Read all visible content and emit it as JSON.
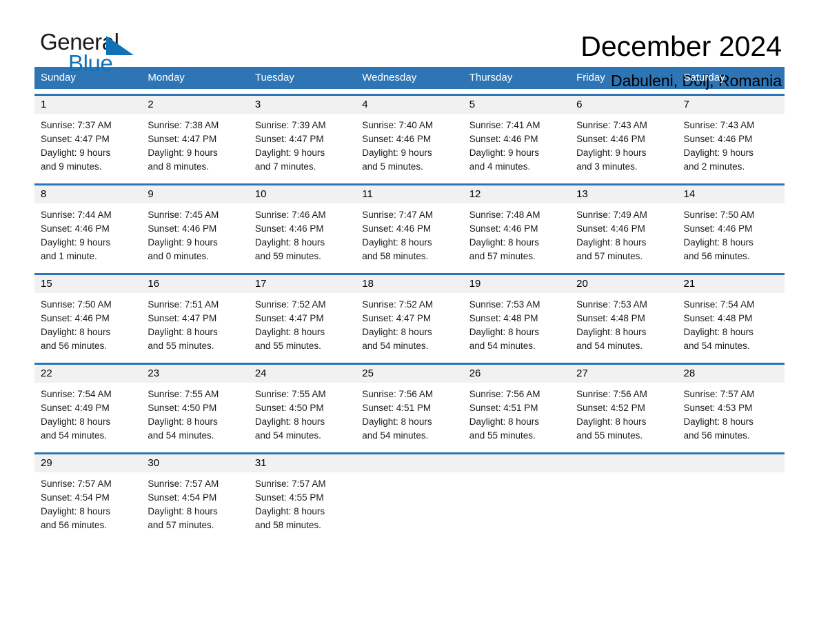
{
  "logo": {
    "word_one": "General",
    "word_two": "Blue",
    "triangle_color": "#1072b8",
    "icon": "triangle-icon"
  },
  "header": {
    "title": "December 2024",
    "subtitle": "Dabuleni, Dolj, Romania"
  },
  "colors": {
    "header_blue": "#2e75b6",
    "row_divider_blue": "#2e75b6",
    "day_strip_gray": "#f1f1f1",
    "text": "#000000",
    "logo_blue": "#1072b8"
  },
  "calendar": {
    "weekday_headers": [
      "Sunday",
      "Monday",
      "Tuesday",
      "Wednesday",
      "Thursday",
      "Friday",
      "Saturday"
    ],
    "weeks": [
      [
        {
          "day": "1",
          "sunrise": "Sunrise: 7:37 AM",
          "sunset": "Sunset: 4:47 PM",
          "daylight1": "Daylight: 9 hours",
          "daylight2": "and 9 minutes."
        },
        {
          "day": "2",
          "sunrise": "Sunrise: 7:38 AM",
          "sunset": "Sunset: 4:47 PM",
          "daylight1": "Daylight: 9 hours",
          "daylight2": "and 8 minutes."
        },
        {
          "day": "3",
          "sunrise": "Sunrise: 7:39 AM",
          "sunset": "Sunset: 4:47 PM",
          "daylight1": "Daylight: 9 hours",
          "daylight2": "and 7 minutes."
        },
        {
          "day": "4",
          "sunrise": "Sunrise: 7:40 AM",
          "sunset": "Sunset: 4:46 PM",
          "daylight1": "Daylight: 9 hours",
          "daylight2": "and 5 minutes."
        },
        {
          "day": "5",
          "sunrise": "Sunrise: 7:41 AM",
          "sunset": "Sunset: 4:46 PM",
          "daylight1": "Daylight: 9 hours",
          "daylight2": "and 4 minutes."
        },
        {
          "day": "6",
          "sunrise": "Sunrise: 7:43 AM",
          "sunset": "Sunset: 4:46 PM",
          "daylight1": "Daylight: 9 hours",
          "daylight2": "and 3 minutes."
        },
        {
          "day": "7",
          "sunrise": "Sunrise: 7:43 AM",
          "sunset": "Sunset: 4:46 PM",
          "daylight1": "Daylight: 9 hours",
          "daylight2": "and 2 minutes."
        }
      ],
      [
        {
          "day": "8",
          "sunrise": "Sunrise: 7:44 AM",
          "sunset": "Sunset: 4:46 PM",
          "daylight1": "Daylight: 9 hours",
          "daylight2": "and 1 minute."
        },
        {
          "day": "9",
          "sunrise": "Sunrise: 7:45 AM",
          "sunset": "Sunset: 4:46 PM",
          "daylight1": "Daylight: 9 hours",
          "daylight2": "and 0 minutes."
        },
        {
          "day": "10",
          "sunrise": "Sunrise: 7:46 AM",
          "sunset": "Sunset: 4:46 PM",
          "daylight1": "Daylight: 8 hours",
          "daylight2": "and 59 minutes."
        },
        {
          "day": "11",
          "sunrise": "Sunrise: 7:47 AM",
          "sunset": "Sunset: 4:46 PM",
          "daylight1": "Daylight: 8 hours",
          "daylight2": "and 58 minutes."
        },
        {
          "day": "12",
          "sunrise": "Sunrise: 7:48 AM",
          "sunset": "Sunset: 4:46 PM",
          "daylight1": "Daylight: 8 hours",
          "daylight2": "and 57 minutes."
        },
        {
          "day": "13",
          "sunrise": "Sunrise: 7:49 AM",
          "sunset": "Sunset: 4:46 PM",
          "daylight1": "Daylight: 8 hours",
          "daylight2": "and 57 minutes."
        },
        {
          "day": "14",
          "sunrise": "Sunrise: 7:50 AM",
          "sunset": "Sunset: 4:46 PM",
          "daylight1": "Daylight: 8 hours",
          "daylight2": "and 56 minutes."
        }
      ],
      [
        {
          "day": "15",
          "sunrise": "Sunrise: 7:50 AM",
          "sunset": "Sunset: 4:46 PM",
          "daylight1": "Daylight: 8 hours",
          "daylight2": "and 56 minutes."
        },
        {
          "day": "16",
          "sunrise": "Sunrise: 7:51 AM",
          "sunset": "Sunset: 4:47 PM",
          "daylight1": "Daylight: 8 hours",
          "daylight2": "and 55 minutes."
        },
        {
          "day": "17",
          "sunrise": "Sunrise: 7:52 AM",
          "sunset": "Sunset: 4:47 PM",
          "daylight1": "Daylight: 8 hours",
          "daylight2": "and 55 minutes."
        },
        {
          "day": "18",
          "sunrise": "Sunrise: 7:52 AM",
          "sunset": "Sunset: 4:47 PM",
          "daylight1": "Daylight: 8 hours",
          "daylight2": "and 54 minutes."
        },
        {
          "day": "19",
          "sunrise": "Sunrise: 7:53 AM",
          "sunset": "Sunset: 4:48 PM",
          "daylight1": "Daylight: 8 hours",
          "daylight2": "and 54 minutes."
        },
        {
          "day": "20",
          "sunrise": "Sunrise: 7:53 AM",
          "sunset": "Sunset: 4:48 PM",
          "daylight1": "Daylight: 8 hours",
          "daylight2": "and 54 minutes."
        },
        {
          "day": "21",
          "sunrise": "Sunrise: 7:54 AM",
          "sunset": "Sunset: 4:48 PM",
          "daylight1": "Daylight: 8 hours",
          "daylight2": "and 54 minutes."
        }
      ],
      [
        {
          "day": "22",
          "sunrise": "Sunrise: 7:54 AM",
          "sunset": "Sunset: 4:49 PM",
          "daylight1": "Daylight: 8 hours",
          "daylight2": "and 54 minutes."
        },
        {
          "day": "23",
          "sunrise": "Sunrise: 7:55 AM",
          "sunset": "Sunset: 4:50 PM",
          "daylight1": "Daylight: 8 hours",
          "daylight2": "and 54 minutes."
        },
        {
          "day": "24",
          "sunrise": "Sunrise: 7:55 AM",
          "sunset": "Sunset: 4:50 PM",
          "daylight1": "Daylight: 8 hours",
          "daylight2": "and 54 minutes."
        },
        {
          "day": "25",
          "sunrise": "Sunrise: 7:56 AM",
          "sunset": "Sunset: 4:51 PM",
          "daylight1": "Daylight: 8 hours",
          "daylight2": "and 54 minutes."
        },
        {
          "day": "26",
          "sunrise": "Sunrise: 7:56 AM",
          "sunset": "Sunset: 4:51 PM",
          "daylight1": "Daylight: 8 hours",
          "daylight2": "and 55 minutes."
        },
        {
          "day": "27",
          "sunrise": "Sunrise: 7:56 AM",
          "sunset": "Sunset: 4:52 PM",
          "daylight1": "Daylight: 8 hours",
          "daylight2": "and 55 minutes."
        },
        {
          "day": "28",
          "sunrise": "Sunrise: 7:57 AM",
          "sunset": "Sunset: 4:53 PM",
          "daylight1": "Daylight: 8 hours",
          "daylight2": "and 56 minutes."
        }
      ],
      [
        {
          "day": "29",
          "sunrise": "Sunrise: 7:57 AM",
          "sunset": "Sunset: 4:54 PM",
          "daylight1": "Daylight: 8 hours",
          "daylight2": "and 56 minutes."
        },
        {
          "day": "30",
          "sunrise": "Sunrise: 7:57 AM",
          "sunset": "Sunset: 4:54 PM",
          "daylight1": "Daylight: 8 hours",
          "daylight2": "and 57 minutes."
        },
        {
          "day": "31",
          "sunrise": "Sunrise: 7:57 AM",
          "sunset": "Sunset: 4:55 PM",
          "daylight1": "Daylight: 8 hours",
          "daylight2": "and 58 minutes."
        },
        {
          "day": "",
          "sunrise": "",
          "sunset": "",
          "daylight1": "",
          "daylight2": ""
        },
        {
          "day": "",
          "sunrise": "",
          "sunset": "",
          "daylight1": "",
          "daylight2": ""
        },
        {
          "day": "",
          "sunrise": "",
          "sunset": "",
          "daylight1": "",
          "daylight2": ""
        },
        {
          "day": "",
          "sunrise": "",
          "sunset": "",
          "daylight1": "",
          "daylight2": ""
        }
      ]
    ]
  }
}
